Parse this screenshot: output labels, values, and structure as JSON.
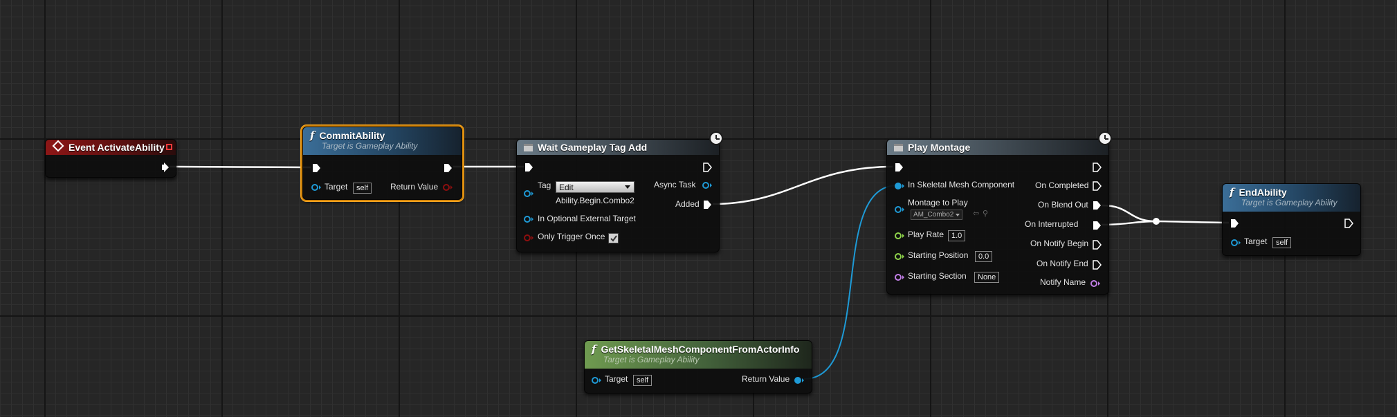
{
  "nodes": {
    "event": {
      "title": "Event ActivateAbility"
    },
    "commit": {
      "title": "CommitAbility",
      "subtitle": "Target is Gameplay Ability",
      "target_label": "Target",
      "target_value": "self",
      "return_label": "Return Value"
    },
    "wait": {
      "title": "Wait Gameplay Tag Add",
      "tag_label": "Tag",
      "tag_dropdown": "Edit",
      "tag_value": "Ability.Begin.Combo2",
      "async_label": "Async Task",
      "added_label": "Added",
      "external_label": "In Optional External Target",
      "trigger_label": "Only Trigger Once"
    },
    "montage": {
      "title": "Play Montage",
      "mesh_label": "In Skeletal Mesh Component",
      "montage_label": "Montage to Play",
      "montage_value": "AM_Combo2",
      "rate_label": "Play Rate",
      "rate_value": "1.0",
      "start_pos_label": "Starting Position",
      "start_pos_value": "0.0",
      "section_label": "Starting Section",
      "section_value": "None",
      "completed_label": "On Completed",
      "blendout_label": "On Blend Out",
      "interrupted_label": "On Interrupted",
      "notify_begin_label": "On Notify Begin",
      "notify_end_label": "On Notify End",
      "notify_name_label": "Notify Name"
    },
    "getmesh": {
      "title": "GetSkeletalMeshComponentFromActorInfo",
      "subtitle": "Target is Gameplay Ability",
      "target_label": "Target",
      "target_value": "self",
      "return_label": "Return Value"
    },
    "end": {
      "title": "EndAbility",
      "subtitle": "Target is Gameplay Ability",
      "target_label": "Target",
      "target_value": "self"
    }
  },
  "colors": {
    "exec": "#ffffff",
    "object_pin": "#1e9ad6",
    "bool_pin": "#8e0f0f",
    "float_pin": "#8fd44b",
    "name_pin": "#c17ee6",
    "selected_outline": "#f5a623"
  },
  "icons": {
    "event": "event-diamond-icon",
    "function": "function-f-icon",
    "latent": "clock-icon",
    "macro": "macro-icon"
  }
}
